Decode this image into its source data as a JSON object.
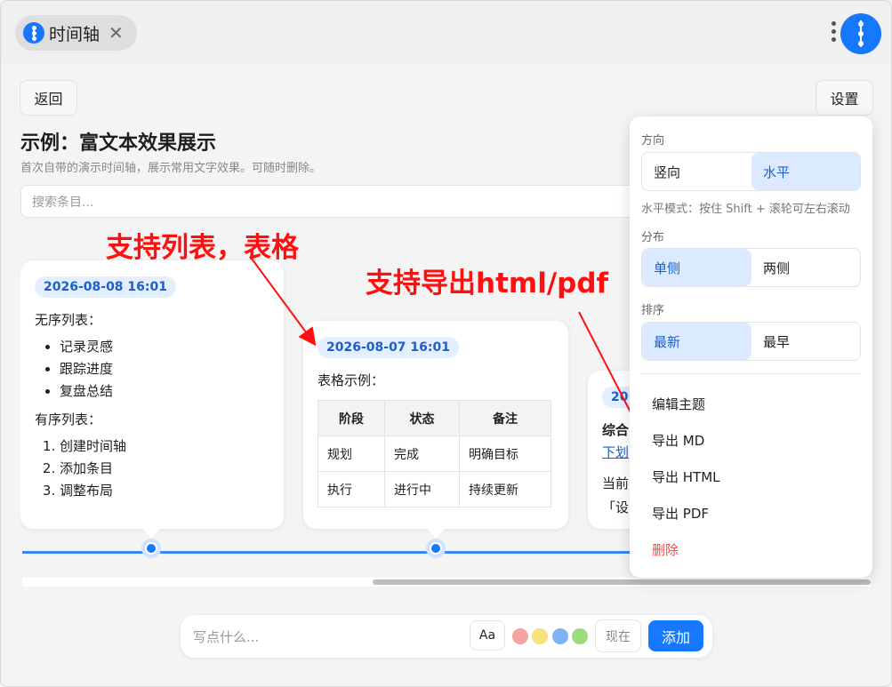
{
  "tab": {
    "title": "时间轴",
    "close": "✕"
  },
  "toolbar": {
    "back": "返回",
    "settings": "设置"
  },
  "page": {
    "title": "示例：富文本效果展示",
    "subtitle": "首次自带的演示时间轴，展示常用文字效果。可随时删除。",
    "search_placeholder": "搜索条目..."
  },
  "annotations": {
    "list_table": "支持列表，表格",
    "export": "支持导出html/pdf"
  },
  "cards": [
    {
      "date": "2026-08-08 16:01",
      "ul_heading": "无序列表：",
      "ul": [
        "记录灵感",
        "跟踪进度",
        "复盘总结"
      ],
      "ol_heading": "有序列表：",
      "ol": [
        "创建时间轴",
        "添加条目",
        "调整布局"
      ]
    },
    {
      "date": "2026-08-07 16:01",
      "heading": "表格示例：",
      "table": {
        "headers": [
          "阶段",
          "状态",
          "备注"
        ],
        "rows": [
          [
            "规划",
            "完成",
            "明确目标"
          ],
          [
            "执行",
            "进行中",
            "持续更新"
          ]
        ]
      }
    },
    {
      "date": "20",
      "heading": "综合",
      "link": "下划",
      "line1": "当前",
      "line2": "「设"
    }
  ],
  "composer": {
    "placeholder": "写点什么...",
    "aa": "Aa",
    "now": "现在",
    "add": "添加"
  },
  "swatches": [
    "#f5a3a3",
    "#f7e27a",
    "#7fb2f5",
    "#9bdc7f"
  ],
  "settings": {
    "direction_label": "方向",
    "direction_options": [
      "竖向",
      "水平"
    ],
    "direction_selected": "水平",
    "hint": "水平模式：按住 Shift + 滚轮可左右滚动",
    "layout_label": "分布",
    "layout_options": [
      "单侧",
      "两侧"
    ],
    "layout_selected": "单侧",
    "sort_label": "排序",
    "sort_options": [
      "最新",
      "最早"
    ],
    "sort_selected": "最新",
    "menu": [
      "编辑主题",
      "导出 MD",
      "导出 HTML",
      "导出 PDF",
      "删除"
    ]
  },
  "colors": {
    "accent": "#1677ff",
    "danger": "#f04a4a",
    "annotation": "#ff1010"
  }
}
